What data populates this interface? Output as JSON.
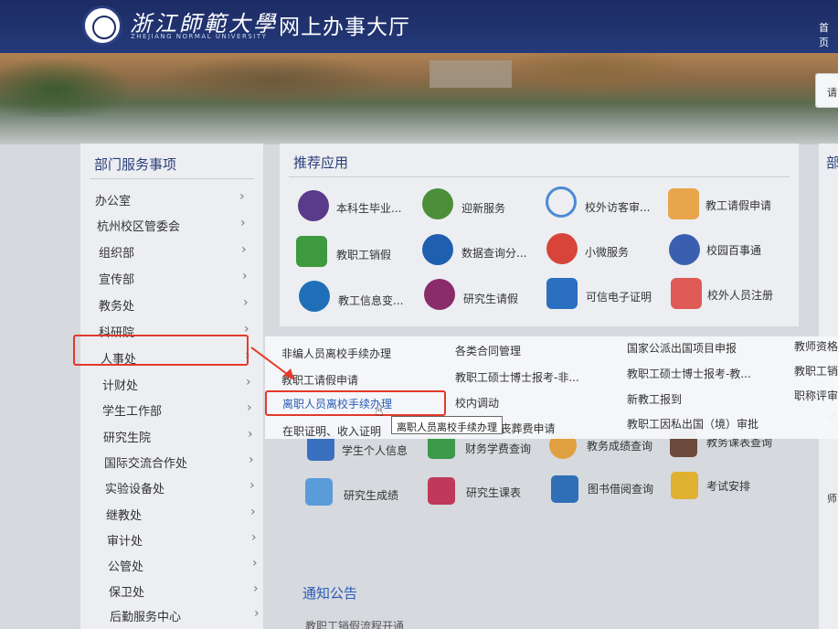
{
  "header": {
    "university_cn": "浙江師範大學",
    "university_en": "ZHEJIANG NORMAL UNIVERSITY",
    "portal_title": "网上办事大厅",
    "home_label": "首页"
  },
  "banner": {
    "search_label": "请"
  },
  "departments": {
    "title": "部门服务事项",
    "items": [
      "办公室",
      "杭州校区管委会",
      "组织部",
      "宣传部",
      "教务处",
      "科研院",
      "人事处",
      "计财处",
      "学生工作部",
      "研究生院",
      "国际交流合作处",
      "实验设备处",
      "继教处",
      "审计处",
      "公管处",
      "保卫处",
      "后勤服务中心"
    ]
  },
  "recommended": {
    "title": "推荐应用",
    "apps": [
      "本科生毕业...",
      "迎新服务",
      "校外访客审...",
      "教工请假申请",
      "教职工销假",
      "数据查询分...",
      "小微服务",
      "校园百事通",
      "教工信息变...",
      "研究生请假",
      "可信电子证明",
      "校外人员注册"
    ]
  },
  "personnel_menu": {
    "col1": [
      "非编人员离校手续办理",
      "教职工请假申请",
      "离职人员离校手续办理",
      "在职证明、收入证明"
    ],
    "col2": [
      "各类合同管理",
      "教职工硕士博士报考-非...",
      "校内调动",
      "...丧葬费申请"
    ],
    "col3": [
      "国家公派出国项目申报",
      "教职工硕士博士报考-教...",
      "新教工报到",
      "教职工因私出国（境）审批"
    ],
    "col4": [
      "教师资格",
      "教职工销",
      "职称评审"
    ]
  },
  "tooltip": "离职人员离校手续办理",
  "student_apps": [
    "学生个人信息",
    "财务学费查询",
    "教务成绩查询",
    "教务课表查询",
    "研究生成绩",
    "研究生课表",
    "图书借阅查询",
    "考试安排"
  ],
  "right_panel": {
    "title": "部",
    "items": [
      "研",
      "师"
    ]
  },
  "notice": {
    "title": "通知公告",
    "first_item": "教职工销假流程开通"
  }
}
